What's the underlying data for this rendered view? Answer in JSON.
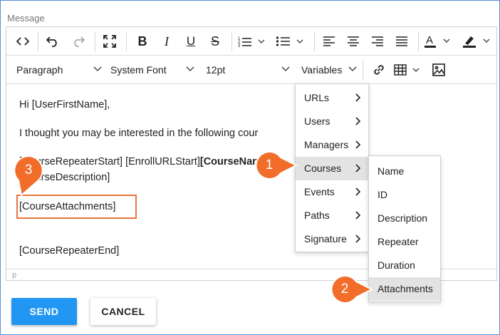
{
  "field": {
    "label": "Message"
  },
  "toolbar": {
    "row1_icons": [
      "source-code-icon",
      "undo-icon",
      "redo-icon",
      "fullscreen-icon",
      "bold-icon",
      "italic-icon",
      "underline-icon",
      "strikethrough-icon",
      "numbered-list-icon",
      "bullet-list-icon",
      "align-left-icon",
      "align-center-icon",
      "align-right-icon",
      "justify-icon",
      "font-color-icon",
      "highlight-color-icon"
    ],
    "format_select": "Paragraph",
    "font_select": "System Font",
    "size_select": "12pt",
    "variables_select": "Variables",
    "row2_icons": [
      "link-icon",
      "table-icon",
      "image-icon"
    ]
  },
  "content": {
    "line1": "Hi [UserFirstName],",
    "line2": "I thought you may be interested in the following cour",
    "line3a": "[CourseRepeaterStart] [EnrollURLStart]",
    "line3b": "[CourseName]",
    "line4": "[CourseDescription]",
    "line5": "[CourseAttachments]",
    "line6": "[CourseRepeaterEnd]"
  },
  "status": {
    "path": "p"
  },
  "variables_menu": [
    {
      "label": "URLs"
    },
    {
      "label": "Users"
    },
    {
      "label": "Managers"
    },
    {
      "label": "Courses"
    },
    {
      "label": "Events"
    },
    {
      "label": "Paths"
    },
    {
      "label": "Signature"
    }
  ],
  "courses_submenu": [
    {
      "label": "Name"
    },
    {
      "label": "ID"
    },
    {
      "label": "Description"
    },
    {
      "label": "Repeater"
    },
    {
      "label": "Duration"
    },
    {
      "label": "Attachments"
    }
  ],
  "callouts": {
    "c1": "1",
    "c2": "2",
    "c3": "3"
  },
  "colors": {
    "callout": "#f26c2a",
    "send": "#2196f3",
    "highlight": "#e8753a"
  },
  "buttons": {
    "send": "SEND",
    "cancel": "CANCEL"
  }
}
